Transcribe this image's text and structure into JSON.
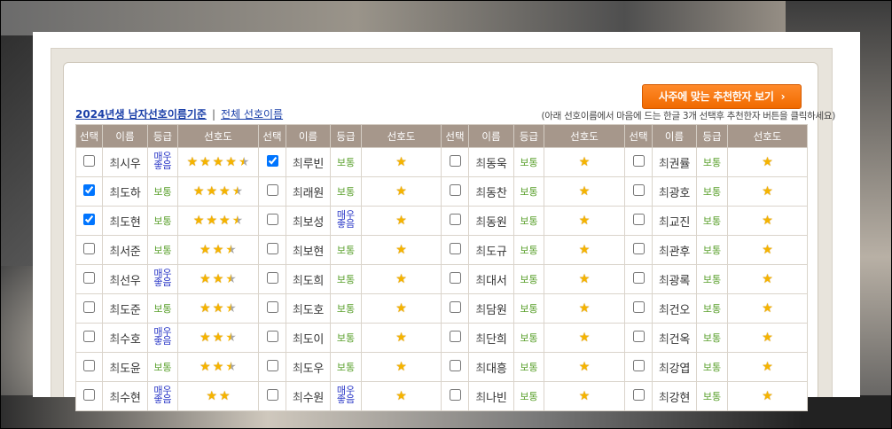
{
  "cta_label": "사주에 맞는 추천한자 보기",
  "cta_icon": "chevron-right-icon",
  "tabs": {
    "active": "2024년생 남자선호이름기준",
    "separator": "|",
    "other": "전체 선호이름"
  },
  "hint": "(아래 선호이름에서 마음에 드는 한글 3개 선택후 추천한자 버튼을 클릭하세요)",
  "headers": {
    "select": "선택",
    "name": "이름",
    "grade": "등급",
    "pref": "선호도"
  },
  "colors": {
    "header_bg": "#a6978b",
    "grade_normal": "#5aa02c",
    "grade_best": "#2f3cc8",
    "star": "#f5b400",
    "cta": "#f06a00"
  },
  "grade_labels": {
    "normal": "보통",
    "best_line1": "매우",
    "best_line2": "좋음"
  },
  "rows": [
    [
      {
        "sur": "최",
        "given": "시우",
        "grade": "best",
        "stars": 4.5,
        "checked": false
      },
      {
        "sur": "최",
        "given": "루빈",
        "grade": "normal",
        "stars": 1,
        "checked": true
      },
      {
        "sur": "최",
        "given": "동욱",
        "grade": "normal",
        "stars": 1,
        "checked": false
      },
      {
        "sur": "최",
        "given": "권률",
        "grade": "normal",
        "stars": 1,
        "checked": false
      }
    ],
    [
      {
        "sur": "최",
        "given": "도하",
        "grade": "normal",
        "stars": 3.5,
        "checked": true
      },
      {
        "sur": "최",
        "given": "래원",
        "grade": "normal",
        "stars": 1,
        "checked": false
      },
      {
        "sur": "최",
        "given": "동찬",
        "grade": "normal",
        "stars": 1,
        "checked": false
      },
      {
        "sur": "최",
        "given": "광호",
        "grade": "normal",
        "stars": 1,
        "checked": false
      }
    ],
    [
      {
        "sur": "최",
        "given": "도현",
        "grade": "normal",
        "stars": 3.5,
        "checked": true
      },
      {
        "sur": "최",
        "given": "보성",
        "grade": "best",
        "stars": 1,
        "checked": false
      },
      {
        "sur": "최",
        "given": "동원",
        "grade": "normal",
        "stars": 1,
        "checked": false
      },
      {
        "sur": "최",
        "given": "교진",
        "grade": "normal",
        "stars": 1,
        "checked": false
      }
    ],
    [
      {
        "sur": "최",
        "given": "서준",
        "grade": "normal",
        "stars": 2.5,
        "checked": false
      },
      {
        "sur": "최",
        "given": "보현",
        "grade": "normal",
        "stars": 1,
        "checked": false
      },
      {
        "sur": "최",
        "given": "도규",
        "grade": "normal",
        "stars": 1,
        "checked": false
      },
      {
        "sur": "최",
        "given": "관후",
        "grade": "normal",
        "stars": 1,
        "checked": false
      }
    ],
    [
      {
        "sur": "최",
        "given": "선우",
        "grade": "best",
        "stars": 2.5,
        "checked": false
      },
      {
        "sur": "최",
        "given": "도희",
        "grade": "normal",
        "stars": 1,
        "checked": false
      },
      {
        "sur": "최",
        "given": "대서",
        "grade": "normal",
        "stars": 1,
        "checked": false
      },
      {
        "sur": "최",
        "given": "광록",
        "grade": "normal",
        "stars": 1,
        "checked": false
      }
    ],
    [
      {
        "sur": "최",
        "given": "도준",
        "grade": "normal",
        "stars": 2.5,
        "checked": false
      },
      {
        "sur": "최",
        "given": "도호",
        "grade": "normal",
        "stars": 1,
        "checked": false
      },
      {
        "sur": "최",
        "given": "담원",
        "grade": "normal",
        "stars": 1,
        "checked": false
      },
      {
        "sur": "최",
        "given": "건오",
        "grade": "normal",
        "stars": 1,
        "checked": false
      }
    ],
    [
      {
        "sur": "최",
        "given": "수호",
        "grade": "best",
        "stars": 2.5,
        "checked": false
      },
      {
        "sur": "최",
        "given": "도이",
        "grade": "normal",
        "stars": 1,
        "checked": false
      },
      {
        "sur": "최",
        "given": "단희",
        "grade": "normal",
        "stars": 1,
        "checked": false
      },
      {
        "sur": "최",
        "given": "건옥",
        "grade": "normal",
        "stars": 1,
        "checked": false
      }
    ],
    [
      {
        "sur": "최",
        "given": "도윤",
        "grade": "normal",
        "stars": 2.5,
        "checked": false
      },
      {
        "sur": "최",
        "given": "도우",
        "grade": "normal",
        "stars": 1,
        "checked": false
      },
      {
        "sur": "최",
        "given": "대흥",
        "grade": "normal",
        "stars": 1,
        "checked": false
      },
      {
        "sur": "최",
        "given": "강엽",
        "grade": "normal",
        "stars": 1,
        "checked": false
      }
    ],
    [
      {
        "sur": "최",
        "given": "수현",
        "grade": "best",
        "stars": 2,
        "checked": false
      },
      {
        "sur": "최",
        "given": "수원",
        "grade": "best",
        "stars": 1,
        "checked": false
      },
      {
        "sur": "최",
        "given": "나빈",
        "grade": "normal",
        "stars": 1,
        "checked": false
      },
      {
        "sur": "최",
        "given": "강현",
        "grade": "normal",
        "stars": 1,
        "checked": false
      }
    ]
  ]
}
